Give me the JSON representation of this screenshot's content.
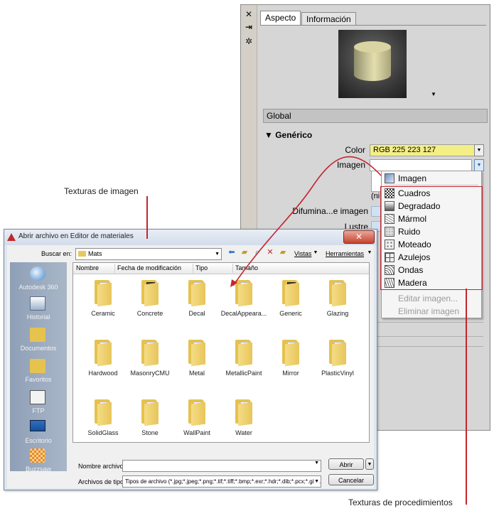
{
  "annotations": {
    "image_textures": "Texturas de imagen",
    "procedural_textures": "Texturas de procedimientos"
  },
  "palette": {
    "tabs": [
      "Aspecto",
      "Información"
    ],
    "section_global": "Global",
    "section_generic": "Genérico",
    "color_label": "Color",
    "color_value": "RGB 225 223 127",
    "image_label": "Imagen",
    "none_text": "(ningun",
    "fade_label": "Difumina...e imagen",
    "gloss_label": "Lustre"
  },
  "menu": {
    "items": [
      "Imagen",
      "Cuadros",
      "Degradado",
      "Mármol",
      "Ruido",
      "Moteado",
      "Azulejos",
      "Ondas",
      "Madera"
    ],
    "disabled_items": [
      "Editar imagen...",
      "Eliminar imagen"
    ]
  },
  "dialog": {
    "title": "Abrir archivo en Editor de materiales",
    "lookin_label": "Buscar en:",
    "lookin_value": "Mats",
    "views_label": "Vistas",
    "tools_label": "Herramientas",
    "columns": [
      "Nombre",
      "Fecha de modificación",
      "Tipo",
      "Tamaño"
    ],
    "places": [
      "Autodesk 360",
      "Historial",
      "Documentos",
      "Favoritos",
      "FTP",
      "Escritorio",
      "Buzzsaw"
    ],
    "folders": [
      "Ceramic",
      "Concrete",
      "Decal",
      "DecalAppeara...",
      "Generic",
      "Glazing",
      "Hardwood",
      "MasonryCMU",
      "Metal",
      "MetallicPaint",
      "Mirror",
      "PlasticVinyl",
      "SolidGlass",
      "Stone",
      "WallPaint",
      "Water"
    ],
    "filename_label": "Nombre archivo:",
    "filetype_label": "Archivos de tipo:",
    "filetype_value": "Tipos de archivo (*.jpg;*.jpeg;*.png;*.tif;*.tiff;*.bmp;*.exr;*.hdr;*.dib;*.pcx;*.gif;*.t",
    "open_button": "Abrir",
    "cancel_button": "Cancelar"
  },
  "colors": {
    "accent_red": "#c5252e",
    "color_swatch": "#f3ef86"
  },
  "icons": [
    "close-icon",
    "pin-icon",
    "settings-icon",
    "back-arrow-icon",
    "up-folder-icon",
    "new-folder-icon",
    "search-web-icon",
    "delete-icon"
  ]
}
